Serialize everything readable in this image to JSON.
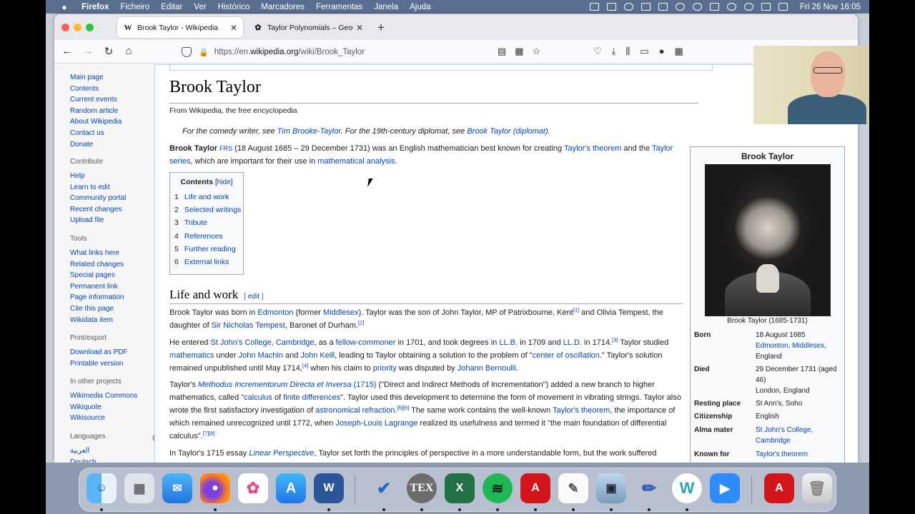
{
  "menubar": {
    "apple": "",
    "app": "Firefox",
    "items": [
      "Ficheiro",
      "Editar",
      "Ver",
      "Histórico",
      "Marcadores",
      "Ferramentas",
      "Janela",
      "Ajuda"
    ],
    "clock": "Fri 26 Nov  16:05"
  },
  "browser": {
    "tabs": [
      {
        "favicon": "W",
        "title": "Brook Taylor - Wikipedia",
        "close": "✕"
      },
      {
        "favicon": "✿",
        "title": "Taylor Polynomials – GeoGebra",
        "close": "✕"
      }
    ],
    "new_tab": "+",
    "url_prefix": "https://en.",
    "url_host": "wikipedia.org",
    "url_path": "/wiki/Brook_Taylor"
  },
  "sidebar": {
    "nav": [
      "Main page",
      "Contents",
      "Current events",
      "Random article",
      "About Wikipedia",
      "Contact us",
      "Donate"
    ],
    "contribute_head": "Contribute",
    "contribute": [
      "Help",
      "Learn to edit",
      "Community portal",
      "Recent changes",
      "Upload file"
    ],
    "tools_head": "Tools",
    "tools": [
      "What links here",
      "Related changes",
      "Special pages",
      "Permanent link",
      "Page information",
      "Cite this page",
      "Wikidata item"
    ],
    "print_head": "Print/export",
    "print": [
      "Download as PDF",
      "Printable version"
    ],
    "projects_head": "In other projects",
    "projects": [
      "Wikimedia Commons",
      "Wikiquote",
      "Wikisource"
    ],
    "languages_head": "Languages",
    "languages": [
      "العربية",
      "Deutsch"
    ]
  },
  "article": {
    "title": "Brook Taylor",
    "tagline": "From Wikipedia, the free encyclopedia",
    "hatnote": {
      "t1": "For the comedy writer, see ",
      "l1": "Tim Brooke-Taylor",
      "t2": ". For the 19th-century diplomat, see ",
      "l2": "Brook Taylor (diplomat)",
      "t3": "."
    },
    "lead": {
      "name": "Brook Taylor",
      "frs": "FRS",
      "t1": " (18 August 1685 – 29 December 1731) was an English mathematician best known for creating ",
      "l1": "Taylor's theorem",
      "t2": " and the ",
      "l2": "Taylor series",
      "t3": ", which are important for their use in ",
      "l3": "mathematical analysis",
      "t4": "."
    },
    "toc": {
      "title": "Contents",
      "hide_open": "[",
      "hide": "hide",
      "hide_close": "]",
      "items": [
        {
          "num": "1",
          "label": "Life and work"
        },
        {
          "num": "2",
          "label": "Selected writings"
        },
        {
          "num": "3",
          "label": "Tribute"
        },
        {
          "num": "4",
          "label": "References"
        },
        {
          "num": "5",
          "label": "Further reading"
        },
        {
          "num": "6",
          "label": "External links"
        }
      ]
    },
    "section": {
      "title": "Life and work",
      "edit_open": "[ ",
      "edit": "edit",
      "edit_close": " ]"
    },
    "p1": {
      "t1": "Brook Taylor was born in ",
      "l1": "Edmonton",
      "t2": " (former ",
      "l2": "Middlesex",
      "t3": "). Taylor was the son of John Taylor, MP of Patrixbourne, Kent",
      "s1": "[1]",
      "t4": " and Olivia Tempest, the daughter of ",
      "l3": "Sir Nicholas Tempest",
      "t5": ", Baronet of Durham.",
      "s2": "[2]"
    },
    "p2": {
      "t1": "He entered ",
      "l1": "St John's College, Cambridge",
      "t2": ", as a ",
      "l2": "fellow-commoner",
      "t3": " in 1701, and took degrees in ",
      "l3": "LL.B.",
      "t4": " in 1709 and ",
      "l4": "LL.D.",
      "t5": " in 1714.",
      "s1": "[3]",
      "t6": " Taylor studied ",
      "l5": "mathematics",
      "t7": " under ",
      "l6": "John Machin",
      "t8": " and ",
      "l7": "John Keill",
      "t9": ", leading to Taylor obtaining a solution to the problem of \"",
      "l8": "center of oscillation",
      "t10": ".\" Taylor's solution remained unpublished until May 1714,",
      "s2": "[4]",
      "t11": " when his claim to ",
      "l9": "priority",
      "t12": " was disputed by ",
      "l10": "Johann Bernoulli",
      "t13": "."
    },
    "p3": {
      "t1": "Taylor's ",
      "l1": "Methodus Incrementorum Directa et Inversa",
      "l2": " (1715)",
      "t2": " (\"Direct and Indirect Methods of Incrementation\") added a new branch to higher mathematics, called \"",
      "l3": "calculus",
      "t3": " of ",
      "l4": "finite differences",
      "t4": "\". Taylor used this development to determine the form of movement in vibrating strings. Taylor also wrote the first satisfactory investigation of ",
      "l5": "astronomical refraction",
      "t5": ".",
      "s1": "[5][6]",
      "t6": " The same work contains the well-known ",
      "l6": "Taylor's theorem",
      "t7": ", the importance of which remained unrecognized until 1772, when ",
      "l7": "Joseph-Louis Lagrange",
      "t8": " realized its usefulness and termed it \"the main foundation of differential calculus\".",
      "s2": "[7][8]"
    },
    "p4": {
      "t1": "In Taylor's 1715 essay ",
      "l1": "Linear Perspective",
      "t2": ", Taylor set forth the principles of perspective in a more understandable form, but the work suffered"
    }
  },
  "infobox": {
    "title": "Brook Taylor",
    "caption": "Brook Taylor (1685-1731)",
    "born_label": "Born",
    "born_date": "18 August 1685",
    "born_l1": "Edmonton",
    "born_sep": ", ",
    "born_l2": "Middlesex",
    "born_tail": ",",
    "born_country": "England",
    "died_label": "Died",
    "died_date": "29 December 1731 (aged",
    "died_age": "46)",
    "died_place": "London, England",
    "resting_label": "Resting place",
    "resting": "St Ann's, Soho",
    "citizenship_label": "Citizenship",
    "citizenship": "English",
    "alma_label": "Alma mater",
    "alma_1": "St John's College,",
    "alma_2": "Cambridge",
    "known_label": "Known for",
    "known": "Taylor's theorem"
  },
  "dock": [
    "Finder",
    "Launchpad",
    "Mail",
    "Firefox",
    "Photos",
    "App Store",
    "Word",
    "To Do",
    "TeX",
    "Excel",
    "Spotify",
    "Acrobat",
    "TextEdit",
    "Preview",
    "Pencil",
    "Whiteboard",
    "Zoom",
    "Acrobat Reader",
    "Trash"
  ]
}
